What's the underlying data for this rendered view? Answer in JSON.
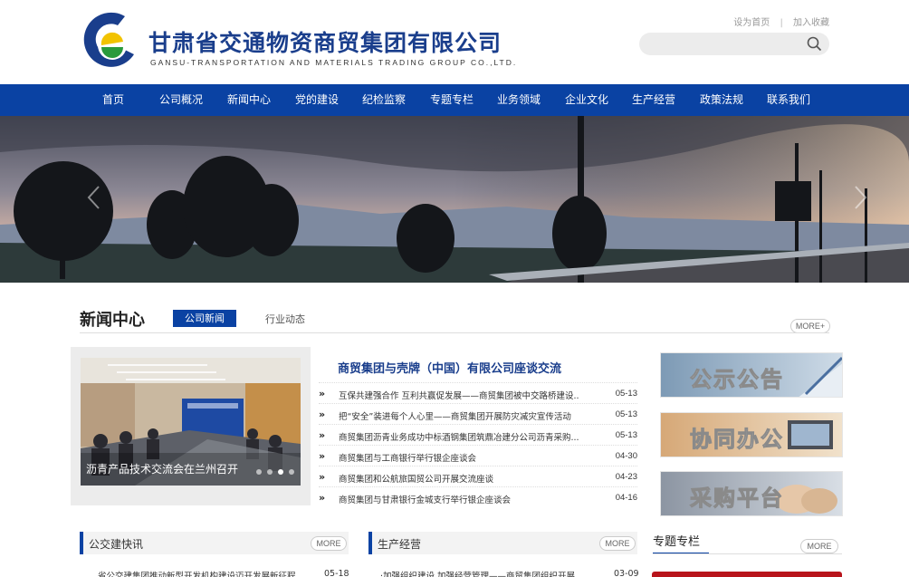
{
  "header": {
    "logo_cn": "甘肃省交通物资商贸集团有限公司",
    "logo_en": "GANSU-TRANSPORTATION AND MATERIALS TRADING GROUP CO.,LTD.",
    "link_home": "设为首页",
    "link_separator": "|",
    "link_favorite": "加入收藏",
    "search_placeholder": "",
    "search_icon": "search-icon"
  },
  "nav": {
    "items": [
      "首页",
      "公司概况",
      "新闻中心",
      "党的建设",
      "纪检监察",
      "专题专栏",
      "业务领域",
      "企业文化",
      "生产经营",
      "政策法规",
      "联系我们"
    ]
  },
  "news_center": {
    "title": "新闻中心",
    "tab_active": "公司新闻",
    "tab_other": "行业动态",
    "more": "MORE+",
    "photo_caption": "沥青产品技术交流会在兰州召开",
    "headline": "商贸集团与壳牌（中国）有限公司座谈交流",
    "list": [
      {
        "arrow": "»",
        "title": "互保共建强合作 互利共赢促发展——商贸集团被中交路桥建设...",
        "date": "05-13"
      },
      {
        "arrow": "»",
        "title": "把“安全”装进每个人心里——商贸集团开展防灾减灾宣传活动",
        "date": "05-13"
      },
      {
        "arrow": "»",
        "title": "商贸集团沥青业务成功中标酒钢集团筑鼎冶建分公司沥青采购...",
        "date": "05-13"
      },
      {
        "arrow": "»",
        "title": "商贸集团与工商银行举行银企座谈会",
        "date": "04-30"
      },
      {
        "arrow": "»",
        "title": "商贸集团和公航旅国贸公司开展交流座谈",
        "date": "04-23"
      },
      {
        "arrow": "»",
        "title": "商贸集团与甘肃银行金城支行举行银企座谈会",
        "date": "04-16"
      }
    ]
  },
  "tiles": [
    "公示公告",
    "协同办公",
    "采购平台"
  ],
  "bottom": {
    "left_title": "公交建快讯",
    "left_more": "MORE",
    "left_row_title": "省公交建集团推动新型开发机构建设迈开发展新征程",
    "left_row_date": "05-18",
    "mid_title": "生产经营",
    "mid_more": "MORE",
    "mid_row_title": "·加强组织建设 加强经营管理——商贸集团组织开展...",
    "mid_row_date": "03-09",
    "right_title": "专题专栏",
    "right_more": "MORE"
  },
  "colors": {
    "brand_blue": "#0a42a3",
    "accent_red": "#b8141b"
  }
}
